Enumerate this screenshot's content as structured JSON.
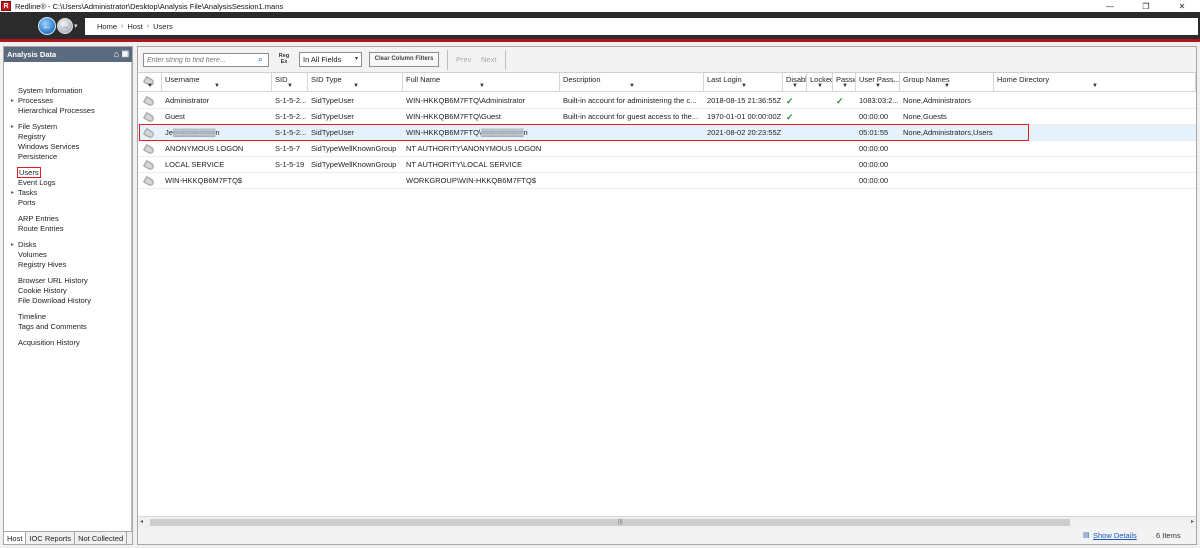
{
  "window": {
    "app_logo": "R",
    "title": "Redline® - C:\\Users\\Administrator\\Desktop\\Analysis File\\AnalysisSession1.mans",
    "minimize": "—",
    "maximize": "❐",
    "close": "✕"
  },
  "nav": {
    "back_icon": "←",
    "forward_icon": "→",
    "dropdown_icon": "▾",
    "breadcrumb": [
      "Home",
      "Host",
      "Users"
    ],
    "separator": "›"
  },
  "sidebar": {
    "title": "Analysis Data",
    "home_icon": "⌂",
    "pin_icon": "▣",
    "items": [
      {
        "label": "System Information",
        "expandable": false
      },
      {
        "label": "Processes",
        "expandable": true
      },
      {
        "label": "Hierarchical Processes",
        "expandable": false
      },
      {
        "label": "File System",
        "expandable": true
      },
      {
        "label": "Registry",
        "expandable": false
      },
      {
        "label": "Windows Services",
        "expandable": false
      },
      {
        "label": "Persistence",
        "expandable": false
      },
      {
        "label": "Users",
        "expandable": false,
        "selected": true
      },
      {
        "label": "Event Logs",
        "expandable": false
      },
      {
        "label": "Tasks",
        "expandable": true
      },
      {
        "label": "Ports",
        "expandable": false
      },
      {
        "label": "ARP Entries",
        "expandable": false
      },
      {
        "label": "Route Entries",
        "expandable": false
      },
      {
        "label": "Disks",
        "expandable": true
      },
      {
        "label": "Volumes",
        "expandable": false
      },
      {
        "label": "Registry Hives",
        "expandable": false
      },
      {
        "label": "Browser URL History",
        "expandable": false
      },
      {
        "label": "Cookie History",
        "expandable": false
      },
      {
        "label": "File Download History",
        "expandable": false
      },
      {
        "label": "Timeline",
        "expandable": false
      },
      {
        "label": "Tags and Comments",
        "expandable": false
      },
      {
        "label": "Acquisition History",
        "expandable": false
      }
    ],
    "expand_glyph": "▸",
    "tabs": [
      "Host",
      "IOC Reports",
      "Not Collected"
    ]
  },
  "toolbar": {
    "search_placeholder": "Enter string to find here...",
    "search_icon": "⌕",
    "regex_line1": "Reg",
    "regex_line2": "Ex",
    "fields_value": "In All Fields",
    "fields_caret": "▾",
    "clear_filters": "Clear Column Filters",
    "prev": "Prev",
    "next": "Next"
  },
  "table": {
    "filter_glyph": "▼",
    "columns": [
      "",
      "Username",
      "SID",
      "SID Type",
      "Full Name",
      "Description",
      "Last Login",
      "Disabled",
      "Locked",
      "Password",
      "User Pass...",
      "Group Names",
      "Home Directory"
    ],
    "column_headers_visible": [
      "",
      "Username",
      "SID",
      "SID Type",
      "Full Name",
      "Description",
      "Last Login",
      "Disable",
      "Lockec",
      "Passwi",
      "User Pass...",
      "Group Names",
      "Home Directory"
    ],
    "rows": [
      [
        "",
        "Administrator",
        "S-1-5-2...",
        "SidTypeUser",
        "WIN-HKKQB6M7FTQ\\Administrator",
        "Built-in account for administering the c...",
        "2018-08-15 21:36:55Z",
        "✓",
        "",
        "✓",
        "1083:03:2...",
        "None,Administrators",
        ""
      ],
      [
        "",
        "Guest",
        "S-1-5-2...",
        "SidTypeUser",
        "WIN-HKKQB6M7FTQ\\Guest",
        "Built-in account for guest access to the...",
        "1970-01-01 00:00:00Z",
        "✓",
        "",
        "",
        "00:00:00",
        "None,Guests",
        ""
      ],
      [
        "",
        "Je▒▒▒▒▒▒▒▒n",
        "S-1-5-2...",
        "SidTypeUser",
        "WIN-HKKQB6M7FTQ\\▒▒▒▒▒▒▒▒n",
        "",
        "2021-08-02 20:23:55Z",
        "",
        "",
        "",
        "05:01:55",
        "None,Administrators,Users",
        ""
      ],
      [
        "",
        "ANONYMOUS LOGON",
        "S-1-5-7",
        "SidTypeWellKnownGroup",
        "NT AUTHORITY\\ANONYMOUS LOGON",
        "",
        "",
        "",
        "",
        "",
        "00:00:00",
        "",
        ""
      ],
      [
        "",
        "LOCAL SERVICE",
        "S-1-5-19",
        "SidTypeWellKnownGroup",
        "NT AUTHORITY\\LOCAL SERVICE",
        "",
        "",
        "",
        "",
        "",
        "00:00:00",
        "",
        ""
      ],
      [
        "",
        "WIN-HKKQB6M7FTQ$",
        "",
        "",
        "WORKGROUP\\WIN-HKKQB6M7FTQ$",
        "",
        "",
        "",
        "",
        "",
        "00:00:00",
        "",
        ""
      ]
    ],
    "selected_row": 2
  },
  "scrollbar": {
    "left": "◂",
    "right": "▸",
    "grip": "|||"
  },
  "status": {
    "details_icon": "▤",
    "details_link": "Show Details",
    "items_count": "6 Items"
  }
}
